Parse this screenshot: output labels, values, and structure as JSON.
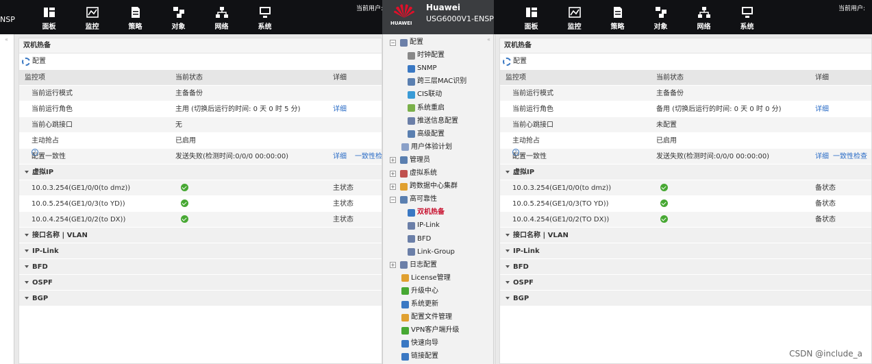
{
  "header": {
    "left_brand": "NSP",
    "nav": [
      "面板",
      "监控",
      "策略",
      "对象",
      "网络",
      "系统"
    ],
    "current_user": "当前用户:",
    "huawei_brand": "Huawei",
    "huawei_small": "HUAWEI",
    "model": "USG6000V1-ENSP"
  },
  "left": {
    "title": "双机热备",
    "config": "配置",
    "headers": [
      "监控项",
      "当前状态",
      "详细"
    ],
    "rows": [
      [
        "当前运行模式",
        "主备备份",
        ""
      ],
      [
        "当前运行角色",
        "主用 (切换后运行的时间: 0 天 0 时 5 分)",
        "详细"
      ],
      [
        "当前心跳接口",
        "无",
        ""
      ],
      [
        "主动抢占",
        "已启用",
        ""
      ],
      [
        "配置一致性",
        "发送失败(检测时间:0/0/0 00:00:00)",
        "详细",
        "一致性检"
      ]
    ],
    "vip": "虚拟IP",
    "ips": [
      [
        "10.0.3.254(GE1/0/0(to dmz))",
        "主状态"
      ],
      [
        "10.0.5.254(GE1/0/3(to YD))",
        "主状态"
      ],
      [
        "10.0.4.254(GE1/0/2(to DX))",
        "主状态"
      ]
    ],
    "sections": [
      "接口名称 | VLAN",
      "IP-Link",
      "BFD",
      "OSPF",
      "BGP"
    ]
  },
  "right": {
    "title": "双机热备",
    "config": "配置",
    "headers": [
      "监控项",
      "当前状态",
      "详细"
    ],
    "rows": [
      [
        "当前运行模式",
        "主备备份",
        ""
      ],
      [
        "当前运行角色",
        "备用 (切换后运行的时间: 0 天 0 时 0 分)",
        "详细"
      ],
      [
        "当前心跳接口",
        "未配置",
        ""
      ],
      [
        "主动抢占",
        "已启用",
        ""
      ],
      [
        "配置一致性",
        "发送失败(检测时间:0/0/0 00:00:00)",
        "详细",
        "一致性检查"
      ]
    ],
    "vip": "虚拟IP",
    "ips": [
      [
        "10.0.3.254(GE1/0/0(to dmz))",
        "备状态"
      ],
      [
        "10.0.5.254(GE1/0/3(TO YD))",
        "备状态"
      ],
      [
        "10.0.4.254(GE1/0/2(TO DX))",
        "备状态"
      ]
    ],
    "sections": [
      "接口名称 | VLAN",
      "IP-Link",
      "BFD",
      "OSPF",
      "BGP"
    ]
  },
  "menu": {
    "items": [
      {
        "label": "配置",
        "box": "−",
        "icon": "#6b7fa8"
      },
      {
        "label": "时钟配置",
        "icon": "#888"
      },
      {
        "label": "SNMP",
        "icon": "#3a78c3"
      },
      {
        "label": "跨三层MAC识别",
        "icon": "#5a7fb0"
      },
      {
        "label": "CIS联动",
        "icon": "#3a9bd6"
      },
      {
        "label": "系统重启",
        "icon": "#7ab04a"
      },
      {
        "label": "推送信息配置",
        "icon": "#6b7fa8"
      },
      {
        "label": "高级配置",
        "icon": "#5a7fb0"
      },
      {
        "label": "用户体验计划",
        "icon": "#8aa0c8"
      },
      {
        "label": "管理员",
        "box": "+",
        "icon": "#5a7fb0"
      },
      {
        "label": "虚拟系统",
        "box": "+",
        "icon": "#c0504d"
      },
      {
        "label": "跨数据中心集群",
        "box": "+",
        "icon": "#e0a030"
      },
      {
        "label": "高可靠性",
        "box": "−",
        "icon": "#5a7fb0"
      },
      {
        "label": "双机热备",
        "icon": "#3a78c3"
      },
      {
        "label": "IP-Link",
        "icon": "#6b7fa8"
      },
      {
        "label": "BFD",
        "icon": "#6b7fa8"
      },
      {
        "label": "Link-Group",
        "icon": "#6b7fa8"
      },
      {
        "label": "日志配置",
        "box": "+",
        "icon": "#6b7fa8"
      },
      {
        "label": "License管理",
        "icon": "#e0a030"
      },
      {
        "label": "升级中心",
        "icon": "#47a833"
      },
      {
        "label": "系统更新",
        "icon": "#3a78c3"
      },
      {
        "label": "配置文件管理",
        "icon": "#e0a030"
      },
      {
        "label": "VPN客户端升级",
        "icon": "#47a833"
      },
      {
        "label": "快速向导",
        "icon": "#3a78c3"
      },
      {
        "label": "链接配置",
        "icon": "#3a78c3"
      }
    ]
  },
  "watermark": "CSDN @include_a"
}
